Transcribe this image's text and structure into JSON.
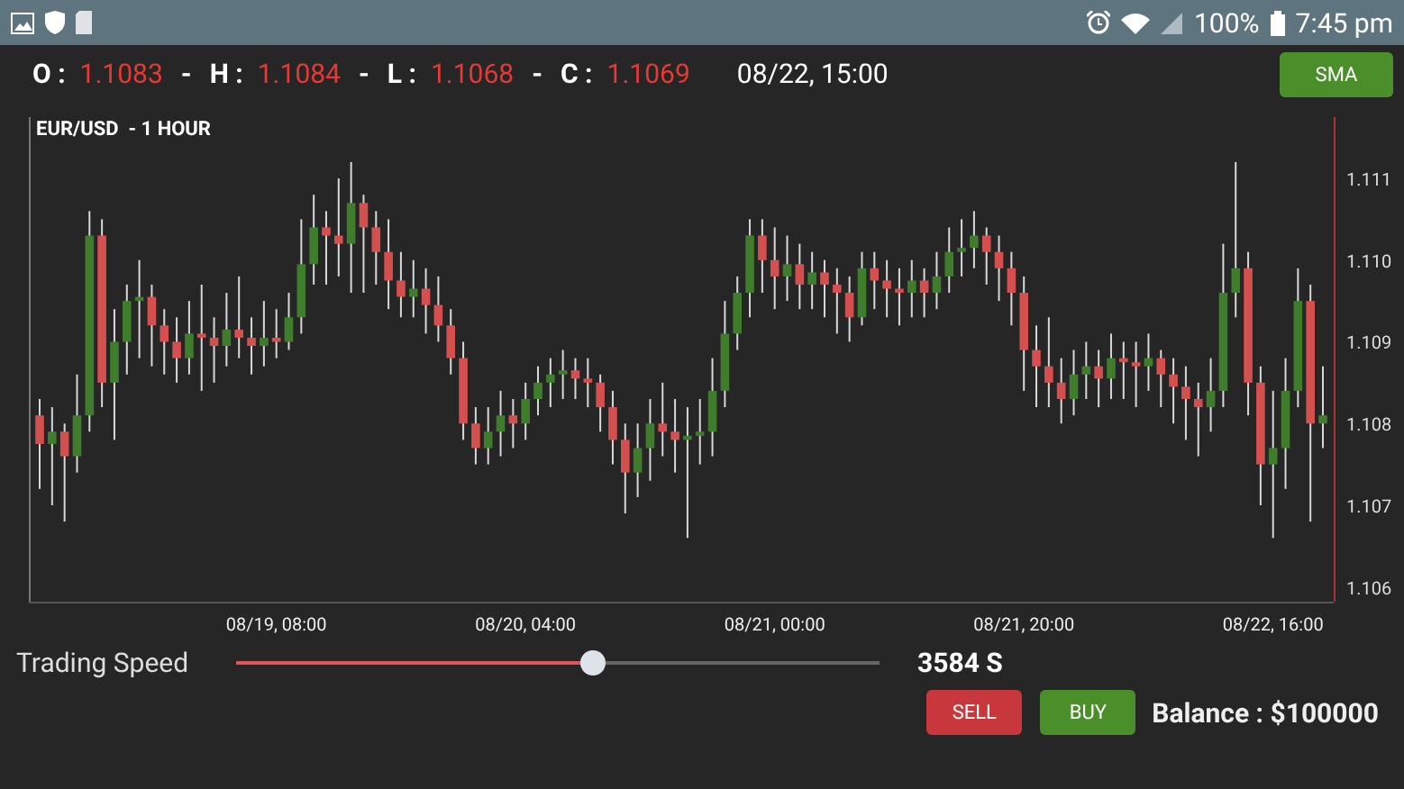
{
  "status_bar": {
    "battery": "100%",
    "time": "7:45 pm"
  },
  "quote": {
    "items": [
      {
        "label": "O :",
        "value": "1.1083"
      },
      {
        "sep": "-",
        "label": "H :",
        "value": "1.1084"
      },
      {
        "sep": "-",
        "label": "L :",
        "value": "1.1068"
      },
      {
        "sep": "-",
        "label": "C :",
        "value": "1.1069"
      }
    ],
    "timestamp": "08/22, 15:00"
  },
  "sma_button": "SMA",
  "chart": {
    "chart_data": {
      "type": "candlestick",
      "title": "EUR/USD  - 1 HOUR",
      "ylim": [
        1.10582,
        1.11175
      ],
      "categories": [
        null,
        null,
        null,
        null,
        null,
        null,
        null,
        null,
        null,
        null,
        null,
        null,
        null,
        null,
        null,
        null,
        null,
        null,
        null,
        "08/19, 08:00",
        null,
        null,
        null,
        null,
        null,
        null,
        null,
        null,
        null,
        null,
        null,
        null,
        null,
        null,
        null,
        null,
        null,
        null,
        null,
        "08/20, 04:00",
        null,
        null,
        null,
        null,
        null,
        null,
        null,
        null,
        null,
        null,
        null,
        null,
        null,
        null,
        null,
        null,
        null,
        null,
        null,
        "08/21, 00:00",
        null,
        null,
        null,
        null,
        null,
        null,
        null,
        null,
        null,
        null,
        null,
        null,
        null,
        null,
        null,
        null,
        null,
        null,
        null,
        "08/21, 20:00",
        null,
        null,
        null,
        null,
        null,
        null,
        null,
        null,
        null,
        null,
        null,
        null,
        null,
        null,
        null,
        null,
        null,
        null,
        null,
        "08/22, 16:00",
        null,
        null,
        null,
        null
      ],
      "yticks": [
        1.111,
        {
          "value": 1.11,
          "label": "1.110"
        },
        1.109,
        1.108,
        1.107,
        1.106
      ],
      "ohlc": [
        [
          1.1081,
          1.1083,
          1.1072,
          1.10775
        ],
        [
          1.10775,
          1.1082,
          1.107,
          1.1079
        ],
        [
          1.1079,
          1.108,
          1.1068,
          1.1076
        ],
        [
          1.1076,
          1.1086,
          1.1074,
          1.1081
        ],
        [
          1.1081,
          1.1106,
          1.1079,
          1.1103
        ],
        [
          1.1103,
          1.1105,
          1.1082,
          1.1085
        ],
        [
          1.1085,
          1.1094,
          1.1078,
          1.109
        ],
        [
          1.109,
          1.1097,
          1.1086,
          1.1095
        ],
        [
          1.1095,
          1.11,
          1.1088,
          1.10955
        ],
        [
          1.10955,
          1.1097,
          1.1087,
          1.1092
        ],
        [
          1.1092,
          1.1094,
          1.1086,
          1.109
        ],
        [
          1.109,
          1.1093,
          1.1085,
          1.1088
        ],
        [
          1.1088,
          1.1095,
          1.1086,
          1.1091
        ],
        [
          1.1091,
          1.1097,
          1.1084,
          1.10905
        ],
        [
          1.10905,
          1.1093,
          1.1085,
          1.10895
        ],
        [
          1.10895,
          1.1096,
          1.1087,
          1.10915
        ],
        [
          1.10915,
          1.1098,
          1.1088,
          1.10905
        ],
        [
          1.10905,
          1.1093,
          1.1086,
          1.10895
        ],
        [
          1.10895,
          1.1095,
          1.1087,
          1.10905
        ],
        [
          1.10905,
          1.1094,
          1.1088,
          1.109
        ],
        [
          1.109,
          1.1096,
          1.1089,
          1.1093
        ],
        [
          1.1093,
          1.1105,
          1.1091,
          1.10995
        ],
        [
          1.10995,
          1.1108,
          1.1097,
          1.1104
        ],
        [
          1.1104,
          1.1106,
          1.1097,
          1.1103
        ],
        [
          1.1103,
          1.111,
          1.1098,
          1.1102
        ],
        [
          1.1102,
          1.1112,
          1.1096,
          1.1107
        ],
        [
          1.1107,
          1.1108,
          1.1096,
          1.1104
        ],
        [
          1.1104,
          1.1106,
          1.1097,
          1.1101
        ],
        [
          1.1101,
          1.1105,
          1.1094,
          1.10975
        ],
        [
          1.10975,
          1.1101,
          1.1093,
          1.10955
        ],
        [
          1.10955,
          1.11,
          1.1093,
          1.10965
        ],
        [
          1.10965,
          1.1099,
          1.1091,
          1.10945
        ],
        [
          1.10945,
          1.1098,
          1.109,
          1.1092
        ],
        [
          1.1092,
          1.1094,
          1.1086,
          1.1088
        ],
        [
          1.1088,
          1.109,
          1.1078,
          1.108
        ],
        [
          1.108,
          1.1082,
          1.1075,
          1.1077
        ],
        [
          1.1077,
          1.1082,
          1.1075,
          1.1079
        ],
        [
          1.1079,
          1.1084,
          1.1076,
          1.1081
        ],
        [
          1.1081,
          1.1083,
          1.1077,
          1.108
        ],
        [
          1.108,
          1.1085,
          1.1078,
          1.1083
        ],
        [
          1.1083,
          1.1087,
          1.1081,
          1.1085
        ],
        [
          1.1085,
          1.1088,
          1.1082,
          1.1086
        ],
        [
          1.1086,
          1.1089,
          1.1083,
          1.10865
        ],
        [
          1.10865,
          1.1088,
          1.1083,
          1.10855
        ],
        [
          1.10855,
          1.1088,
          1.1082,
          1.1085
        ],
        [
          1.1085,
          1.1086,
          1.1079,
          1.1082
        ],
        [
          1.1082,
          1.1084,
          1.1075,
          1.1078
        ],
        [
          1.1078,
          1.108,
          1.1069,
          1.1074
        ],
        [
          1.1074,
          1.108,
          1.1071,
          1.1077
        ],
        [
          1.1077,
          1.1083,
          1.1073,
          1.108
        ],
        [
          1.108,
          1.1085,
          1.1076,
          1.1079
        ],
        [
          1.1079,
          1.1083,
          1.1074,
          1.1078
        ],
        [
          1.1078,
          1.1082,
          1.1066,
          1.10785
        ],
        [
          1.10785,
          1.1083,
          1.1075,
          1.1079
        ],
        [
          1.1079,
          1.1088,
          1.1076,
          1.1084
        ],
        [
          1.1084,
          1.1095,
          1.1082,
          1.1091
        ],
        [
          1.1091,
          1.1098,
          1.1089,
          1.1096
        ],
        [
          1.1096,
          1.1105,
          1.1093,
          1.1103
        ],
        [
          1.1103,
          1.1105,
          1.1096,
          1.11
        ],
        [
          1.11,
          1.1104,
          1.1094,
          1.1098
        ],
        [
          1.1098,
          1.1103,
          1.1095,
          1.10995
        ],
        [
          1.10995,
          1.1102,
          1.1094,
          1.1097
        ],
        [
          1.1097,
          1.1101,
          1.1094,
          1.10985
        ],
        [
          1.10985,
          1.11,
          1.1093,
          1.1097
        ],
        [
          1.1097,
          1.1099,
          1.1091,
          1.1096
        ],
        [
          1.1096,
          1.1098,
          1.109,
          1.1093
        ],
        [
          1.1093,
          1.1101,
          1.1092,
          1.1099
        ],
        [
          1.1099,
          1.1101,
          1.1094,
          1.10975
        ],
        [
          1.10975,
          1.11,
          1.1093,
          1.10965
        ],
        [
          1.10965,
          1.1099,
          1.1092,
          1.1096
        ],
        [
          1.1096,
          1.11,
          1.1093,
          1.10975
        ],
        [
          1.10975,
          1.1099,
          1.1093,
          1.1096
        ],
        [
          1.1096,
          1.1101,
          1.1094,
          1.1098
        ],
        [
          1.1098,
          1.1104,
          1.1096,
          1.1101
        ],
        [
          1.1101,
          1.1105,
          1.1098,
          1.11015
        ],
        [
          1.11015,
          1.1106,
          1.1099,
          1.1103
        ],
        [
          1.1103,
          1.1104,
          1.1097,
          1.1101
        ],
        [
          1.1101,
          1.1103,
          1.1095,
          1.1099
        ],
        [
          1.1099,
          1.1101,
          1.1092,
          1.1096
        ],
        [
          1.1096,
          1.1098,
          1.1084,
          1.1089
        ],
        [
          1.1089,
          1.1092,
          1.1082,
          1.1087
        ],
        [
          1.1087,
          1.1093,
          1.1082,
          1.1085
        ],
        [
          1.1085,
          1.1088,
          1.108,
          1.1083
        ],
        [
          1.1083,
          1.1089,
          1.1081,
          1.1086
        ],
        [
          1.1086,
          1.109,
          1.1083,
          1.1087
        ],
        [
          1.1087,
          1.1089,
          1.1082,
          1.10855
        ],
        [
          1.10855,
          1.1091,
          1.1083,
          1.1088
        ],
        [
          1.1088,
          1.109,
          1.1083,
          1.10875
        ],
        [
          1.10875,
          1.109,
          1.1082,
          1.1087
        ],
        [
          1.1087,
          1.1091,
          1.1084,
          1.1088
        ],
        [
          1.1088,
          1.1089,
          1.1082,
          1.1086
        ],
        [
          1.1086,
          1.1088,
          1.108,
          1.10845
        ],
        [
          1.10845,
          1.1087,
          1.1078,
          1.1083
        ],
        [
          1.1083,
          1.1085,
          1.1076,
          1.1082
        ],
        [
          1.1082,
          1.1088,
          1.1079,
          1.1084
        ],
        [
          1.1084,
          1.1102,
          1.1082,
          1.1096
        ],
        [
          1.1096,
          1.1112,
          1.1093,
          1.1099
        ],
        [
          1.1099,
          1.1101,
          1.1081,
          1.1085
        ],
        [
          1.1085,
          1.1087,
          1.107,
          1.1075
        ],
        [
          1.1075,
          1.1084,
          1.1066,
          1.1077
        ],
        [
          1.1077,
          1.1088,
          1.1072,
          1.1084
        ],
        [
          1.1084,
          1.1099,
          1.1082,
          1.1095
        ],
        [
          1.1095,
          1.1097,
          1.1068,
          1.108
        ],
        [
          1.108,
          1.1087,
          1.1077,
          1.1081
        ]
      ]
    }
  },
  "speed": {
    "label": "Trading Speed",
    "level": 0.555,
    "reading": "3584 S"
  },
  "actions": [
    {
      "kind": "sell",
      "label": "SELL"
    },
    {
      "kind": "buy",
      "label": "BUY"
    }
  ],
  "balance": "Balance : $100000"
}
